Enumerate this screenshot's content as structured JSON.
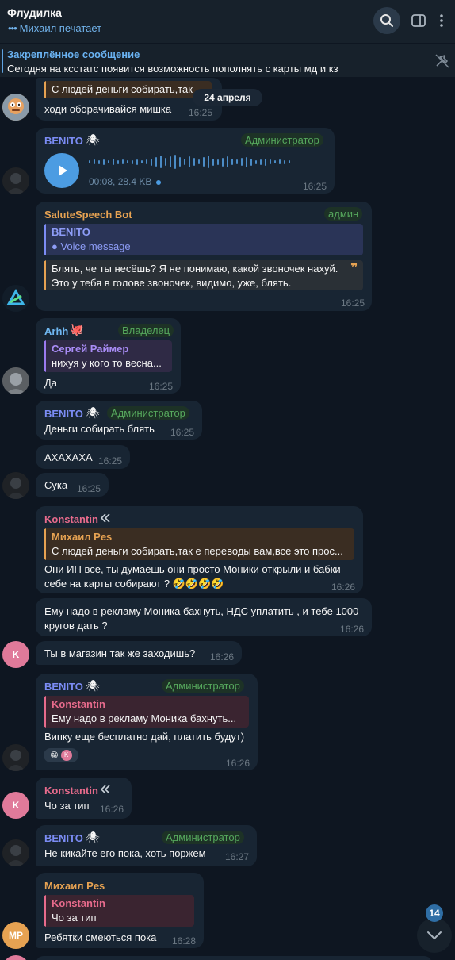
{
  "header": {
    "title": "Флудилка",
    "typing": "Михаил печатает",
    "icons": [
      "search-icon",
      "sidebar-toggle-icon",
      "more-icon"
    ]
  },
  "pinned": {
    "title": "Закреплённое сообщение",
    "text": "Сегодня на ксстатс появится возможность пополнять с карты мд и кз"
  },
  "date_label": "24 апреля",
  "messages": [
    {
      "id": "m1",
      "quote_text": "С людей деньги собирать,так",
      "text": "ходи оборачивайся мишка",
      "time": "16:25"
    },
    {
      "id": "m2",
      "sender": "BENITO",
      "role": "Администратор",
      "voice_info": "00:08, 28.4 KB",
      "time": "16:25"
    },
    {
      "id": "m3",
      "sender": "SaluteSpeech Bot",
      "role": "админ",
      "quote_name": "BENITO",
      "quote_text": "Voice message",
      "text_line1": "Блять, че ты несёшь? Я не понимаю, какой звоночек нахуй.",
      "text_line2": "Это у тебя в голове звоночек, видимо, уже, блять.",
      "time": "16:25"
    },
    {
      "id": "m4",
      "sender": "Arhh",
      "role": "Владелец",
      "quote_name": "Сергей Раймер",
      "quote_text": "нихуя у кого то весна...",
      "text": "Да",
      "time": "16:25"
    },
    {
      "id": "m5",
      "sender": "BENITO",
      "role": "Администратор",
      "text": "Деньги собирать блять",
      "time": "16:25"
    },
    {
      "id": "m6",
      "text": "АХАХАХА",
      "time": "16:25"
    },
    {
      "id": "m7",
      "text": "Сука",
      "time": "16:25"
    },
    {
      "id": "m8",
      "sender": "Konstantin",
      "quote_name": "Михаил Pes",
      "quote_text": "С людей деньги собирать,так е переводы вам,все это прос...",
      "text_line1": "Они ИП все, ты думаешь они просто Моники открыли и бабки",
      "text_line2": "себе на карты собирают ? 🤣🤣🤣🤣",
      "time": "16:26"
    },
    {
      "id": "m9",
      "text_line1": "Ему надо в рекламу Моника бахнуть, НДС уплатить , и тебе 1000",
      "text_line2": "кругов дать ?",
      "time": "16:26"
    },
    {
      "id": "m10",
      "text": "Ты в магазин так же заходишь?",
      "time": "16:26"
    },
    {
      "id": "m11",
      "sender": "BENITO",
      "role": "Администратор",
      "quote_name": "Konstantin",
      "quote_text": "Ему надо в рекламу Моника бахнуть...",
      "text": "Випку еще бесплатно дай, платить будут)",
      "reaction_emoji": "😁",
      "reaction_avatar": "K",
      "time": "16:26"
    },
    {
      "id": "m12",
      "sender": "Konstantin",
      "text": "Чо за тип",
      "time": "16:26"
    },
    {
      "id": "m13",
      "sender": "BENITO",
      "role": "Администратор",
      "text": "Не кикайте его пока, хоть поржем",
      "time": "16:27"
    },
    {
      "id": "m14",
      "sender": "Михаил Pes",
      "quote_name": "Konstantin",
      "quote_text": "Чо за тип",
      "text": "Ребятки смеються пока",
      "time": "16:28"
    }
  ],
  "avatars": {
    "konstantin": "K",
    "mikhail": "MP"
  },
  "unread_count": "14",
  "colors": {
    "background": "#0e1621",
    "bubble": "#182533",
    "accent": "#6ab3f3",
    "role_green": "#56a85d",
    "benito": "#7b8cf4",
    "salute": "#e6a252",
    "konstantin": "#e76b8c",
    "arhh": "#6fb7f0",
    "mikhail": "#e6a252"
  }
}
